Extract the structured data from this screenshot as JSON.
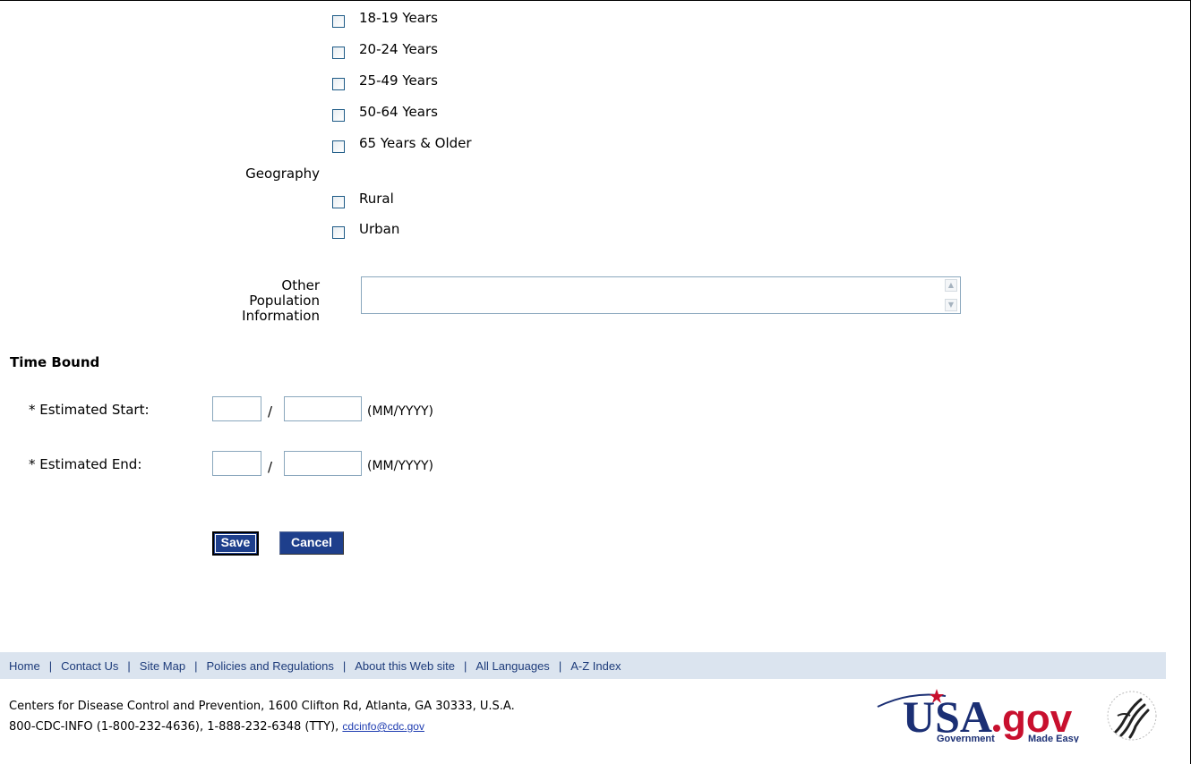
{
  "age_options": [
    {
      "label": "18-19 Years",
      "checked": false
    },
    {
      "label": "20-24 Years",
      "checked": false
    },
    {
      "label": "25-49 Years",
      "checked": false
    },
    {
      "label": "50-64 Years",
      "checked": false
    },
    {
      "label": "65 Years & Older",
      "checked": false
    }
  ],
  "geography": {
    "label": "Geography",
    "options": [
      {
        "label": "Rural",
        "checked": false
      },
      {
        "label": "Urban",
        "checked": false
      }
    ]
  },
  "other_population": {
    "label_line1": "Other",
    "label_line2": "Population",
    "label_line3": "Information",
    "value": ""
  },
  "time_bound": {
    "title": "Time Bound",
    "start_label": "* Estimated Start:",
    "end_label": "* Estimated End:",
    "slash": "/",
    "format_hint": "(MM/YYYY)",
    "start_month": "",
    "start_year": "",
    "end_month": "",
    "end_year": ""
  },
  "buttons": {
    "save": "Save",
    "cancel": "Cancel"
  },
  "footer": {
    "links": [
      "Home",
      "Contact Us",
      "Site Map",
      "Policies and Regulations",
      "About this Web site",
      "All Languages",
      "A-Z Index"
    ],
    "separator": "|",
    "address": "Centers for Disease Control and Prevention, 1600 Clifton Rd, Atlanta, GA 30333, U.S.A.",
    "phone": "800-CDC-INFO (1-800-232-4636), 1-888-232-6348 (TTY),",
    "email": "cdcinfo@cdc.gov",
    "usagov_logo": {
      "main": "USA.gov",
      "sub_left": "Government",
      "sub_right": "Made Easy"
    },
    "hhs_logo": "hhs-seal"
  },
  "colors": {
    "button_bg": "#1e3f8c",
    "footer_bg": "#dbe4ef",
    "link": "#1d3b7a",
    "usagov_blue": "#1b2f74",
    "usagov_red": "#c8102e"
  }
}
